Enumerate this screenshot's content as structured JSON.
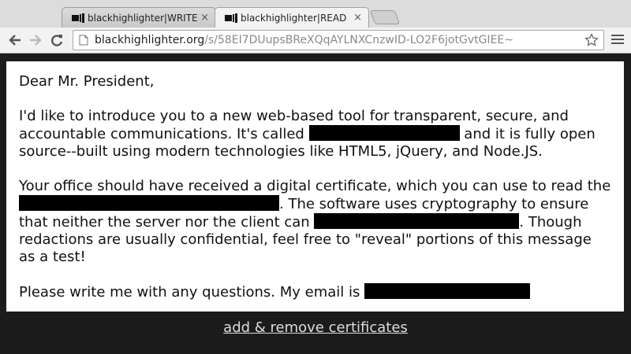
{
  "browser": {
    "tabs": [
      {
        "title": "blackhighlighter|WRITE",
        "active": false
      },
      {
        "title": "blackhighlighter|READ",
        "active": true
      }
    ],
    "close_glyph": "×",
    "url_host": "blackhighlighter.org",
    "url_path": "/s/58EI7DUupsBReXQqAYLNXCnzwID-LO2F6jotGvtGIEE~"
  },
  "letter": {
    "greeting": "Dear Mr. President,",
    "p1_a": "I'd like to introduce you to a new web-based tool for transparent, secure, and accountable communications. It's called ",
    "p1_b": " and it is fully open source--built using modern technologies like HTML5, jQuery, and Node.JS.",
    "p2_a": "Your office should have received a digital certificate, which you can use to read the ",
    "p2_b": ". The software uses cryptography to ensure that neither the server nor the client can ",
    "p2_c": ". Though redactions are usually confidential, feel free to \"reveal\" portions of this message as a test!",
    "p3_a": "Please write me with any questions. My email is "
  },
  "footer": {
    "link_label": "add & remove certificates"
  },
  "icons": {
    "favicon": "black-highlighter-favicon",
    "back": "back-arrow-icon",
    "forward": "forward-arrow-icon",
    "reload": "reload-icon",
    "page": "page-icon",
    "star": "bookmark-star-icon",
    "menu": "hamburger-menu-icon"
  }
}
